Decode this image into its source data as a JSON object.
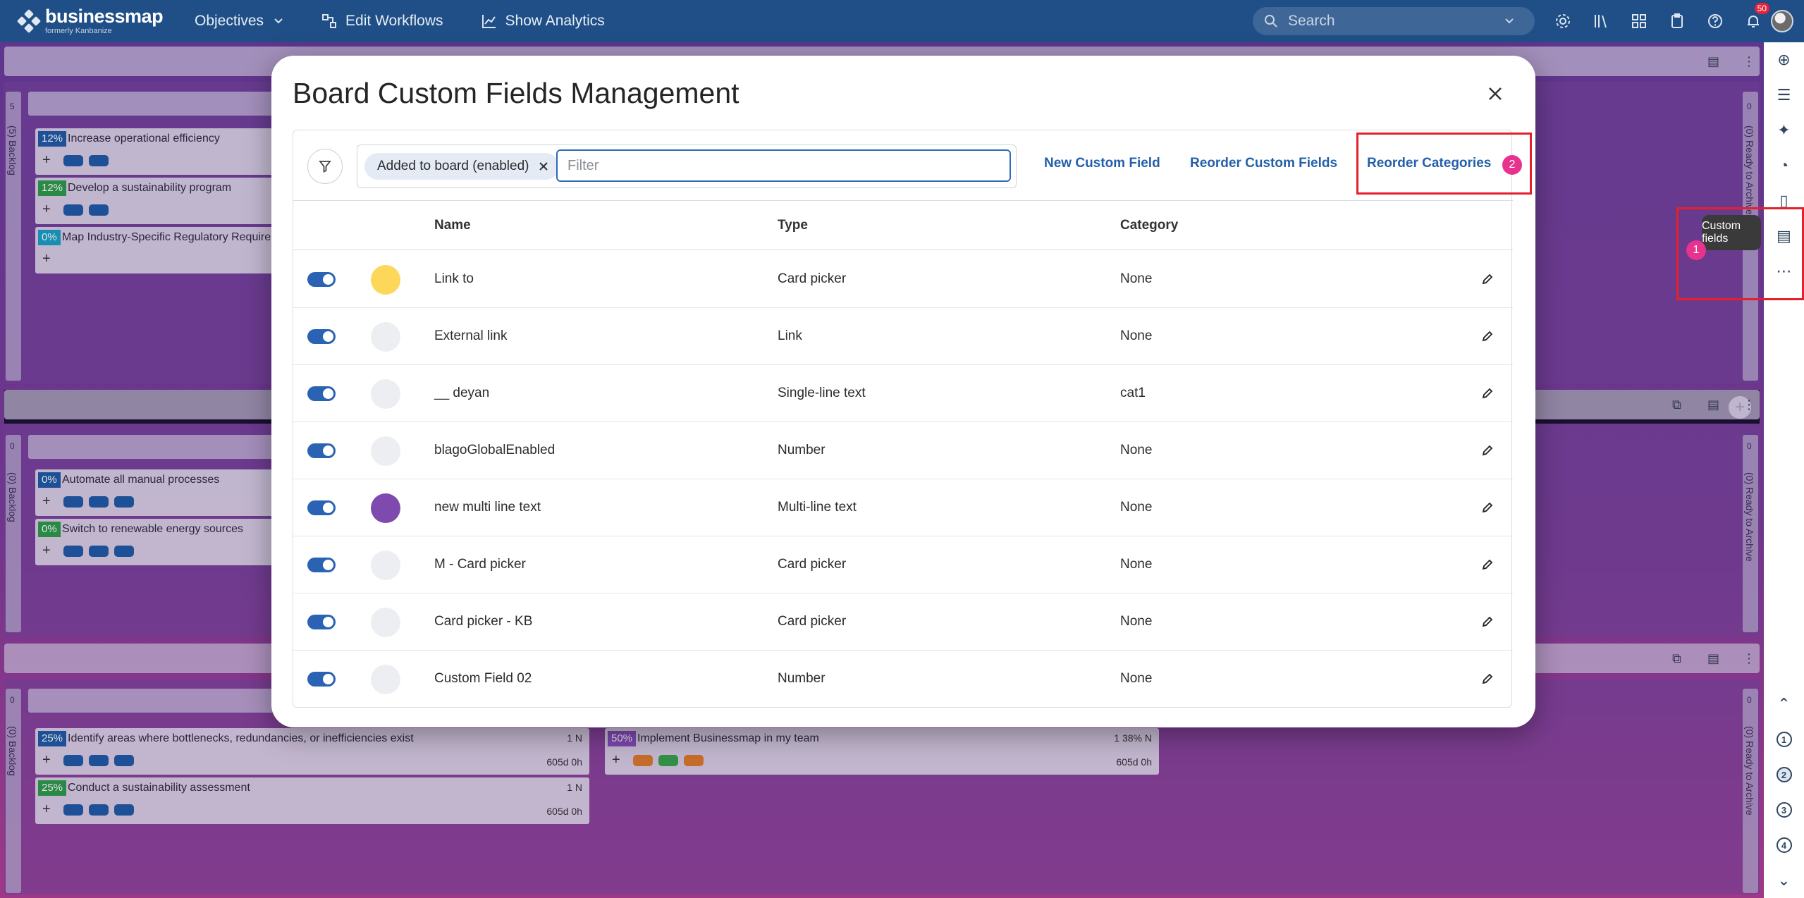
{
  "nav": {
    "brand": "businessmap",
    "brand_sub": "formerly Kanbanize",
    "items": [
      {
        "label": "Objectives",
        "icon": "chevron-down-icon"
      },
      {
        "label": "Edit Workflows",
        "icon": "workflow-icon"
      },
      {
        "label": "Show Analytics",
        "icon": "analytics-icon"
      }
    ],
    "search_placeholder": "Search",
    "notification_count": "50"
  },
  "board": {
    "cards": [
      {
        "pct": "12%",
        "title": "Increase operational efficiency",
        "color": "#1f5aa5"
      },
      {
        "pct": "12%",
        "title": "Develop a sustainability program",
        "color": "#2f9b4a"
      },
      {
        "pct": "0%",
        "title": "Map Industry-Specific Regulatory Requirem",
        "color": "#1aa1c6"
      },
      {
        "pct": "0%",
        "title": "Automate all manual processes",
        "color": "#1f5aa5"
      },
      {
        "pct": "0%",
        "title": "Switch to renewable energy sources",
        "color": "#2f9b4a"
      },
      {
        "pct": "25%",
        "title": "Identify areas where bottlenecks, redundancies, or inefficiencies exist",
        "color": "#1f5aa5",
        "meta_top": "1  N",
        "meta_bottom": "605d  0h"
      },
      {
        "pct": "25%",
        "title": "Conduct a sustainability assessment",
        "color": "#2f9b4a",
        "meta_top": "1  N",
        "meta_bottom": "605d  0h"
      },
      {
        "pct": "50%",
        "title": "Implement Businessmap in my team",
        "color": "#8a4fc0",
        "meta_top": "1  38%  N",
        "meta_bottom": "605d  0h"
      }
    ],
    "backlog_labels": [
      "(5) Backlog",
      "(0) Backlog",
      "(0) Backlog"
    ],
    "backlog_counts": [
      "5",
      "0",
      "0"
    ],
    "archive_labels": [
      "(0) Ready to Archive",
      "(0) Ready to Archive",
      "(0) Ready to Archive"
    ],
    "archive_counts": [
      "0",
      "0",
      "0"
    ]
  },
  "tooltip": "Custom fields",
  "callouts": {
    "step1": "1",
    "step2": "2"
  },
  "modal": {
    "title": "Board Custom Fields Management",
    "filter_chip": "Added to board (enabled)",
    "filter_placeholder": "Filter",
    "actions": {
      "new_field": "New Custom Field",
      "reorder_fields": "Reorder Custom Fields",
      "reorder_categories": "Reorder Categories"
    },
    "columns": {
      "name": "Name",
      "type": "Type",
      "category": "Category"
    },
    "rows": [
      {
        "name": "Link to",
        "type": "Card picker",
        "category": "None",
        "color": "#fcd75a",
        "enabled": true
      },
      {
        "name": "External link",
        "type": "Link",
        "category": "None",
        "color": "#eceef1",
        "enabled": true
      },
      {
        "name": "__ deyan",
        "type": "Single-line text",
        "category": "cat1",
        "color": "#eceef1",
        "enabled": true
      },
      {
        "name": "blagoGlobalEnabled",
        "type": "Number",
        "category": "None",
        "color": "#eceef1",
        "enabled": true
      },
      {
        "name": "new multi line text",
        "type": "Multi-line text",
        "category": "None",
        "color": "#7e4aad",
        "enabled": true
      },
      {
        "name": "M - Card picker",
        "type": "Card picker",
        "category": "None",
        "color": "#eceef1",
        "enabled": true
      },
      {
        "name": "Card picker - KB",
        "type": "Card picker",
        "category": "None",
        "color": "#eceef1",
        "enabled": true
      },
      {
        "name": "Custom Field 02",
        "type": "Number",
        "category": "None",
        "color": "#eceef1",
        "enabled": true
      }
    ]
  },
  "rail": {
    "level_numbers": [
      "1",
      "2",
      "3",
      "4"
    ],
    "active_level": "2"
  }
}
